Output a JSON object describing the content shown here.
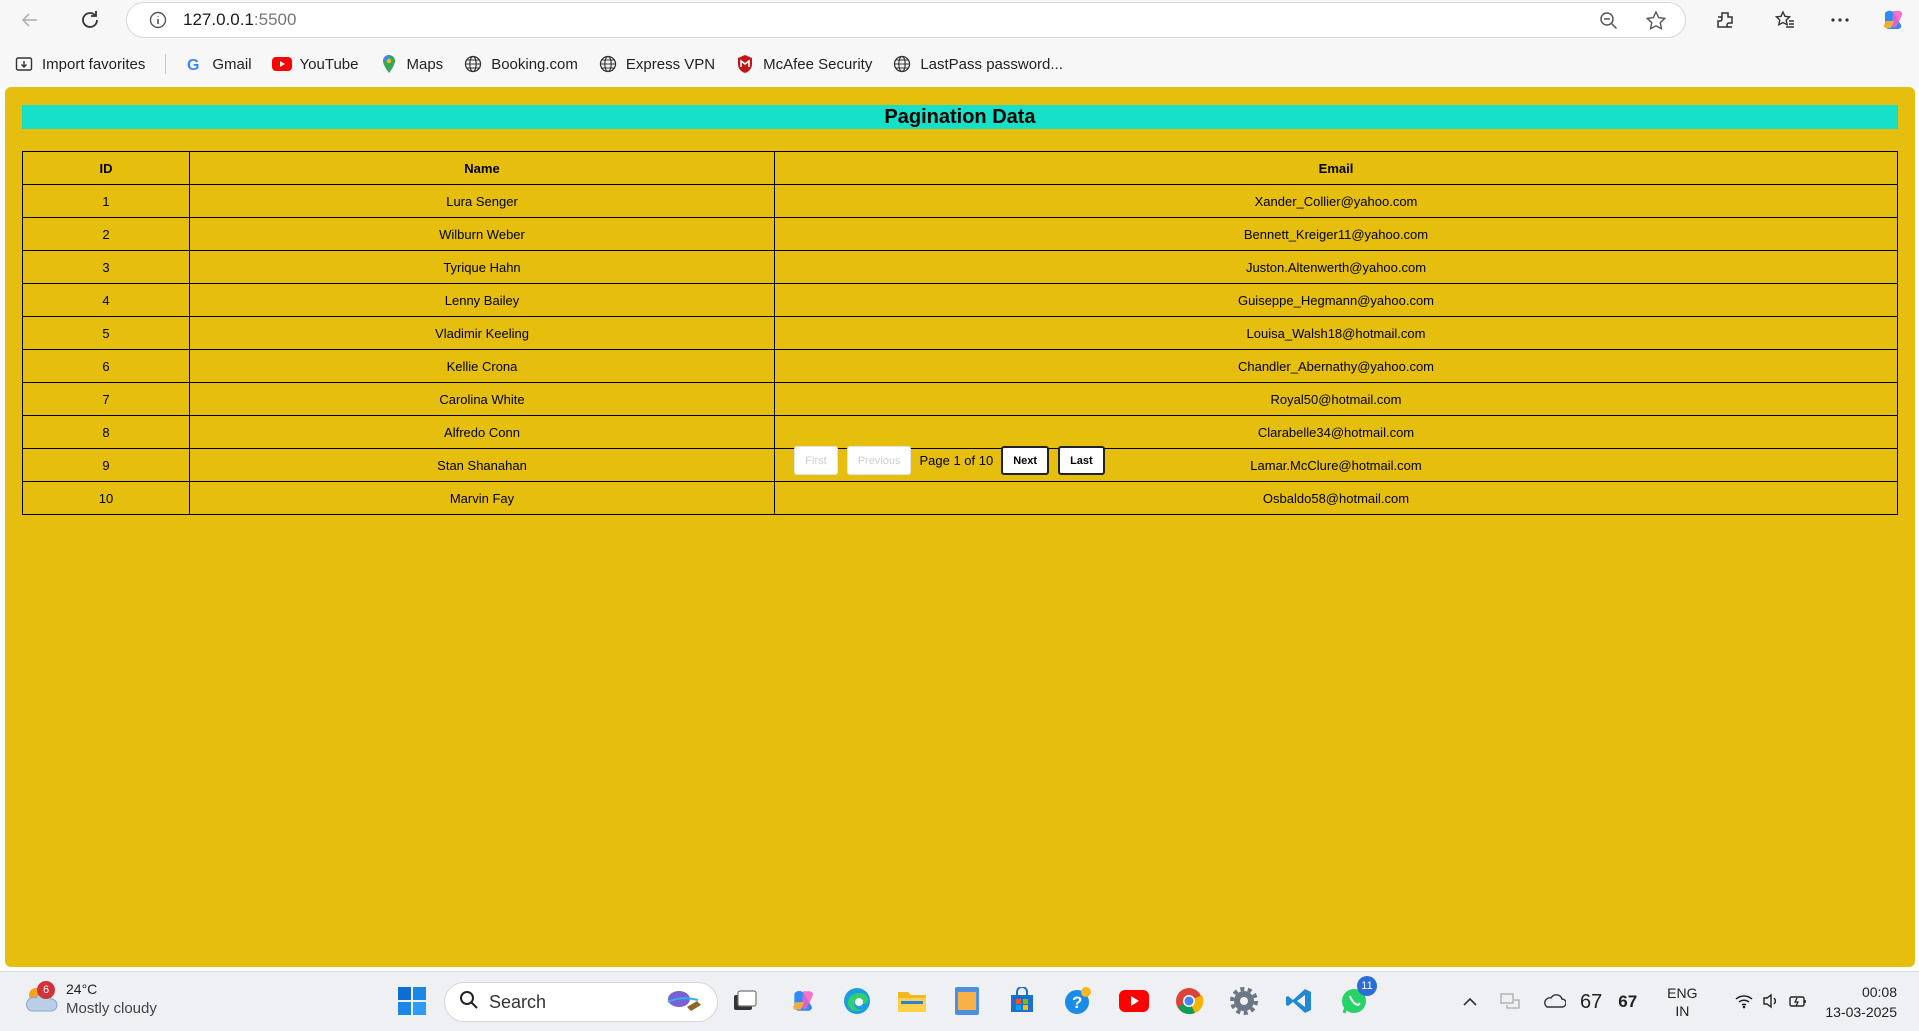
{
  "browser": {
    "url_host": "127.0.0.1",
    "url_port": ":5500",
    "bookmarks": [
      {
        "label": "Import favorites",
        "icon": "import-icon"
      },
      {
        "label": "Gmail",
        "icon": "gmail-icon"
      },
      {
        "label": "YouTube",
        "icon": "youtube-icon"
      },
      {
        "label": "Maps",
        "icon": "maps-icon"
      },
      {
        "label": "Booking.com",
        "icon": "globe-icon"
      },
      {
        "label": "Express VPN",
        "icon": "globe-icon"
      },
      {
        "label": "McAfee Security",
        "icon": "mcafee-icon"
      },
      {
        "label": "LastPass password...",
        "icon": "globe-icon"
      }
    ]
  },
  "page": {
    "title": "Pagination Data",
    "background_color": "#e6bf0e",
    "title_bar_color": "#17e0c8",
    "columns": [
      "ID",
      "Name",
      "Email"
    ],
    "rows": [
      {
        "id": "1",
        "name": "Lura Senger",
        "email": "Xander_Collier@yahoo.com"
      },
      {
        "id": "2",
        "name": "Wilburn Weber",
        "email": "Bennett_Kreiger11@yahoo.com"
      },
      {
        "id": "3",
        "name": "Tyrique Hahn",
        "email": "Juston.Altenwerth@yahoo.com"
      },
      {
        "id": "4",
        "name": "Lenny Bailey",
        "email": "Guiseppe_Hegmann@yahoo.com"
      },
      {
        "id": "5",
        "name": "Vladimir Keeling",
        "email": "Louisa_Walsh18@hotmail.com"
      },
      {
        "id": "6",
        "name": "Kellie Crona",
        "email": "Chandler_Abernathy@yahoo.com"
      },
      {
        "id": "7",
        "name": "Carolina White",
        "email": "Royal50@hotmail.com"
      },
      {
        "id": "8",
        "name": "Alfredo Conn",
        "email": "Clarabelle34@hotmail.com"
      },
      {
        "id": "9",
        "name": "Stan Shanahan",
        "email": "Lamar.McClure@hotmail.com"
      },
      {
        "id": "10",
        "name": "Marvin Fay",
        "email": "Osbaldo58@hotmail.com"
      }
    ],
    "pagination": {
      "first_label": "First",
      "previous_label": "Previous",
      "info": "Page 1 of 10",
      "next_label": "Next",
      "last_label": "Last"
    }
  },
  "taskbar": {
    "weather_badge": "6",
    "temperature": "24°C",
    "condition": "Mostly cloudy",
    "search_label": "Search",
    "whatsapp_badge": "11",
    "tray_num_1": "67",
    "tray_num_2": "67",
    "lang_1": "ENG",
    "lang_2": "IN",
    "time": "00:08",
    "date": "13-03-2025"
  }
}
